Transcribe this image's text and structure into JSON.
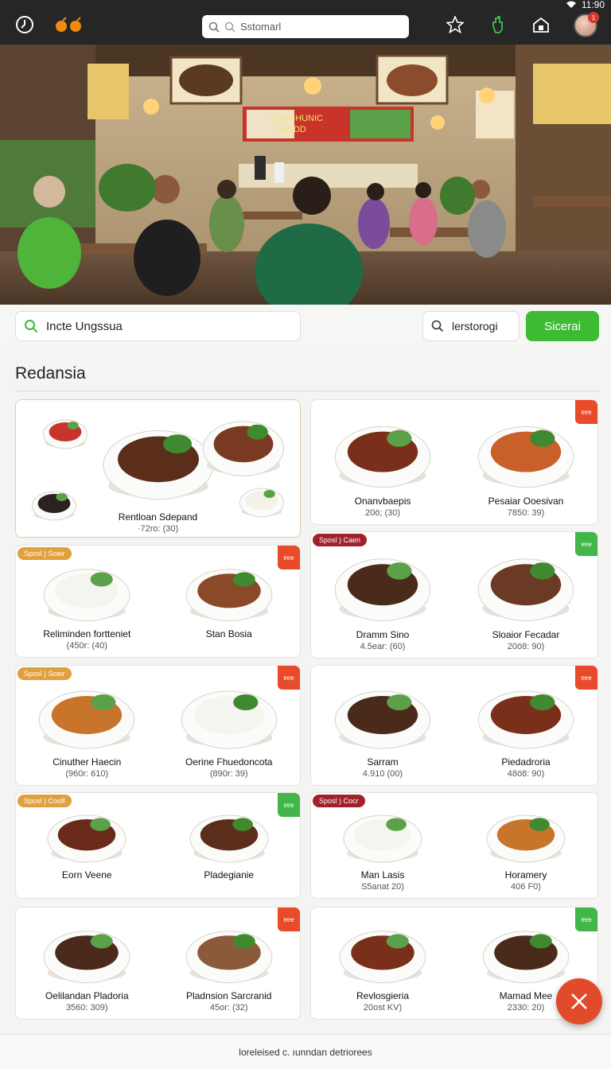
{
  "status_bar": {
    "time": "11:90"
  },
  "header": {
    "search": {
      "value": "Sstomarl"
    },
    "icons": [
      "clock-icon",
      "fruit-logo-icon",
      "search-icon",
      "star-icon",
      "hand-icon",
      "home-icon",
      "avatar"
    ],
    "notification_count": "1"
  },
  "hero": {
    "sign_title": "ENUCHUNIC",
    "sign_sub": "OKCDD"
  },
  "search_row": {
    "location_value": "Incte Ungssua",
    "query_value": "lerstorogi",
    "button_label": "Sicerai"
  },
  "section": {
    "title": "Redansia"
  },
  "cards": [
    {
      "left": {
        "name": "Rentloan Sdepand",
        "price": "·72ro: (30)"
      }
    },
    {
      "left": {
        "name": "Onanvbaepis",
        "price": "20ö; (30)"
      },
      "right": {
        "name": "Pesaiar Ooesivan",
        "price": "7850: 39)"
      },
      "corner": "ɐɐɐ"
    },
    {
      "badge": "Sposl ) Soeir",
      "left": {
        "name": "Reliminden fortteniet",
        "price": "(450r: (40)"
      },
      "right": {
        "name": "Stan Bosia",
        "price": ""
      },
      "corner": "ɐɐɐ"
    },
    {
      "badge": "Sposl ) Caen",
      "left": {
        "name": "Dramm Sino",
        "price": "4.5ear: (60)"
      },
      "right": {
        "name": "Sloaior Fecadar",
        "price": "20ö8: 90)"
      },
      "corner": "ɐɐɐ"
    },
    {
      "badge": "Sposl ) Soeir",
      "left": {
        "name": "Cinuther Haecin",
        "price": "(960r: 610)"
      },
      "right": {
        "name": "Oerine Fhuedoncota",
        "price": "(890r: 39)"
      },
      "corner": "ɐɐɐ"
    },
    {
      "left": {
        "name": "Sarram",
        "price": "4.910 (00)"
      },
      "right": {
        "name": "Piedadroria",
        "price": "48ö8: 90)"
      },
      "corner": "ɐɐɐ"
    },
    {
      "badge": "Sposl ) Coolf",
      "left": {
        "name": "Eorn Veene",
        "price": ""
      },
      "right": {
        "name": "Pladegianie",
        "price": ""
      },
      "corner": "ɐɐɐ"
    },
    {
      "badge": "Sposl ) Cocr",
      "left": {
        "name": "Man Lasis",
        "price": "S5anat 20)"
      },
      "right": {
        "name": "Horamery",
        "price": "406 F0)"
      }
    },
    {
      "left": {
        "name": "Oelilandan Pladoria",
        "price": "3560: 309)"
      },
      "right": {
        "name": "Pladnsion Sarcranid",
        "price": "45or: (32)"
      },
      "corner": "ɐɐɐ"
    },
    {
      "left": {
        "name": "Revlosgieria",
        "price": "20ost KV)"
      },
      "right": {
        "name": "Mamad Mee",
        "price": "2330: 20)"
      },
      "corner": "ɐɐɐ"
    }
  ],
  "colors": {
    "accent_green": "#3dbb32",
    "badge_orange": "#e0a040",
    "badge_red": "#a0222a",
    "corner_red": "#e84a2a",
    "corner_green": "#43b649",
    "fab": "#e24a2c"
  },
  "footer": {
    "text": "loreleised c. ıunndan detriorees"
  }
}
